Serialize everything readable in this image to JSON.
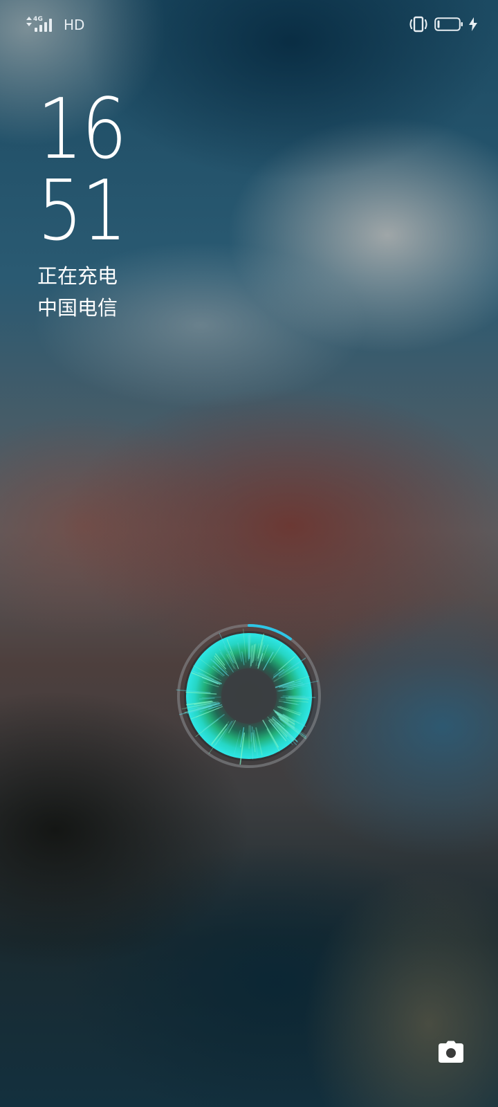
{
  "status_bar": {
    "network_type": "4G",
    "hd_label": "HD",
    "signal_level": 4,
    "battery_level": 0.1,
    "charging": true,
    "icons": [
      "data-arrows-icon",
      "signal-bars-icon",
      "vibrate-icon",
      "battery-icon",
      "charging-bolt-icon"
    ]
  },
  "lockscreen": {
    "clock_hour": "16",
    "clock_minute": "51",
    "charging_status": "正在充电",
    "carrier": "中国电信"
  },
  "charge_indicator": {
    "progress": 0.1,
    "colors": {
      "arc": "#2ec6e6",
      "glow_outer": "#2ee6e6",
      "glow_inner": "#22c77a",
      "track": "#8c8f94"
    }
  },
  "shortcuts": {
    "camera_icon": "camera-icon"
  }
}
